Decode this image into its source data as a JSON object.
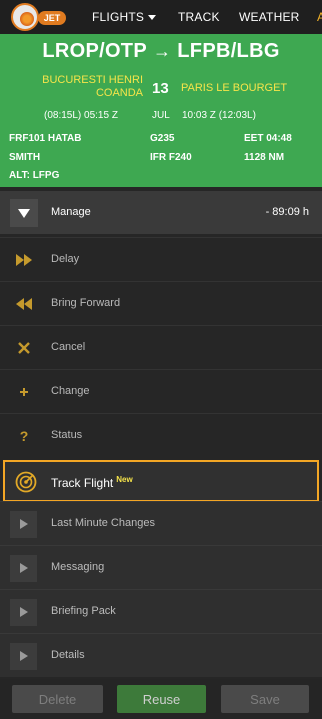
{
  "nav": {
    "logo_text": "JET",
    "items": [
      "FLIGHTS",
      "TRACK",
      "WEATHER",
      "A"
    ]
  },
  "flight": {
    "route_from": "LROP/OTP",
    "route_arrow": "→",
    "route_to": "LFPB/LBG",
    "departure_name": "BUCURESTI HENRI COANDA",
    "day": "13",
    "arrival_name": "PARIS LE BOURGET",
    "departure_time": "(08:15L) 05:15 Z",
    "month": "JUL",
    "arrival_time": "10:03 Z (12:03L)",
    "details": {
      "flight_id": "FRF101 HATAB",
      "aircraft": "G235",
      "eet": "EET 04:48",
      "pilot": "SMITH",
      "flight_rules": "IFR F240",
      "distance": "1128 NM",
      "alternate": "ALT: LFPG"
    }
  },
  "manage": {
    "label": "Manage",
    "time": "- 89:09 h"
  },
  "actions": [
    {
      "label": "Delay",
      "icon": "fast-forward-icon"
    },
    {
      "label": "Bring Forward",
      "icon": "rewind-icon"
    },
    {
      "label": "Cancel",
      "icon": "close-icon"
    },
    {
      "label": "Change",
      "icon": "plus-icon"
    },
    {
      "label": "Status",
      "icon": "question-icon"
    }
  ],
  "track_flight": {
    "label": "Track Flight",
    "badge": "New",
    "icon": "radar-icon"
  },
  "sections": [
    {
      "label": "Last Minute Changes"
    },
    {
      "label": "Messaging"
    },
    {
      "label": "Briefing Pack"
    },
    {
      "label": "Details"
    }
  ],
  "footer": {
    "delete_label": "Delete",
    "reuse_label": "Reuse",
    "save_label": "Save"
  },
  "colors": {
    "header_green": "#3ea851",
    "highlight_orange": "#f3a625",
    "accent_yellow": "#f6e44a",
    "icon_gold": "#c59a2d"
  }
}
